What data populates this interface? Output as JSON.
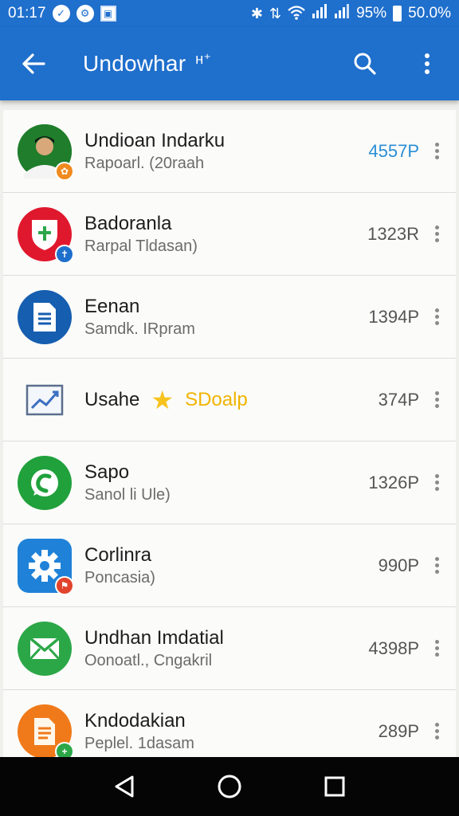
{
  "status_bar": {
    "time": "01:17",
    "battery_percent_1": "95%",
    "battery_percent_2": "50.0%",
    "icons": [
      "check-circle-icon",
      "settings-circle-icon",
      "image-square-icon",
      "bluetooth-icon",
      "data-sync-icon",
      "wifi-icon",
      "signal-icon",
      "signal-icon",
      "battery-icon"
    ]
  },
  "app_bar": {
    "title": "Undowhar",
    "title_badge": "ʜ⁺",
    "icons": [
      "back-arrow-icon",
      "search-icon",
      "more-vert-icon"
    ]
  },
  "items": [
    {
      "title": "Undioan Indarku",
      "subtitle": "Rapoarl. (20raah",
      "value": "4557P",
      "icon": "person-avatar",
      "avatar_color": "#1f7d2b",
      "badge_color": "#f08a1e",
      "badge_glyph": "✿"
    },
    {
      "title": "Badoranla",
      "subtitle": "Rarpal Tldasan)",
      "value": "1323R",
      "icon": "shield-plus-icon",
      "avatar_color": "#e0182d",
      "badge_color": "#1f6fcc",
      "badge_glyph": "✝"
    },
    {
      "title": "Eenan",
      "subtitle": "Samdk. IRpram",
      "value": "1394P",
      "icon": "document-icon",
      "avatar_color": "#155eb0"
    },
    {
      "title": "Usahe",
      "subtitle": "",
      "value": "374P",
      "icon": "trending-chart-icon",
      "highlight_text": "SDoalp",
      "star_icon": "star-icon"
    },
    {
      "title": "Sapo",
      "subtitle": "Sanol li Ule)",
      "value": "1326P",
      "icon": "chat-phone-icon",
      "avatar_color": "#20a13c"
    },
    {
      "title": "Corlinra",
      "subtitle": "Poncasia)",
      "value": "990P",
      "icon": "gear-icon",
      "avatar_color": "#1f82d8",
      "badge_color": "#e2432c",
      "badge_glyph": "⚑"
    },
    {
      "title": "Undhan Imdatial",
      "subtitle": "Oonoatl., Cngakril",
      "value": "4398P",
      "icon": "mail-icon",
      "avatar_color": "#2ca748"
    },
    {
      "title": "Kndodakian",
      "subtitle": "Peplel. 1dasam",
      "value": "289P",
      "icon": "note-icon",
      "avatar_color": "#f07a1a",
      "badge_color": "#2ca748",
      "badge_glyph": "+"
    }
  ],
  "nav_bar": {
    "icons": [
      "back-triangle-icon",
      "home-circle-icon",
      "recents-square-icon"
    ]
  },
  "colors": {
    "primary": "#1f6fcc",
    "accent_value": "#2a8ed6",
    "highlight": "#f0b400"
  }
}
